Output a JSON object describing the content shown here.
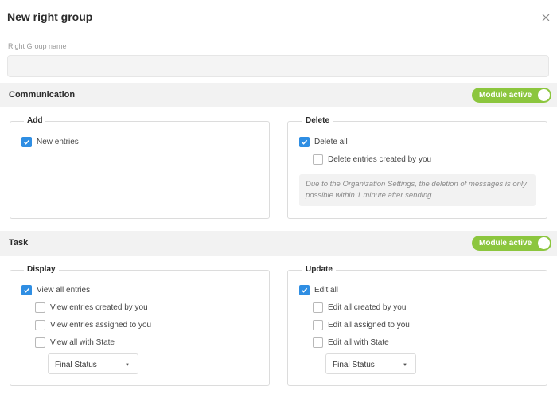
{
  "dialog": {
    "title": "New right group"
  },
  "name_field": {
    "label": "Right Group name",
    "value": "",
    "placeholder": ""
  },
  "communication": {
    "title": "Communication",
    "toggle_label": "Module active",
    "toggle_on": true,
    "add": {
      "title": "Add",
      "new_entries": "New entries"
    },
    "delete": {
      "title": "Delete",
      "delete_all": "Delete all",
      "delete_own": "Delete entries created by you",
      "note": "Due to the Organization Settings, the deletion of messages is only possible within 1 minute after sending."
    }
  },
  "task": {
    "title": "Task",
    "toggle_label": "Module active",
    "toggle_on": true,
    "display": {
      "title": "Display",
      "view_all": "View all entries",
      "view_created": "View entries created by you",
      "view_assigned": "View entries assigned to you",
      "view_state": "View all with State",
      "state_select": "Final Status"
    },
    "update": {
      "title": "Update",
      "edit_all": "Edit all",
      "edit_created": "Edit all created by you",
      "edit_assigned": "Edit all assigned to you",
      "edit_state": "Edit all with State",
      "state_select": "Final Status"
    }
  },
  "colors": {
    "accent": "#2f8ee3",
    "toggle": "#8cc63e"
  },
  "icons": {
    "close": "close-icon",
    "check": "check-icon",
    "dropdown": "caret-down-icon"
  }
}
